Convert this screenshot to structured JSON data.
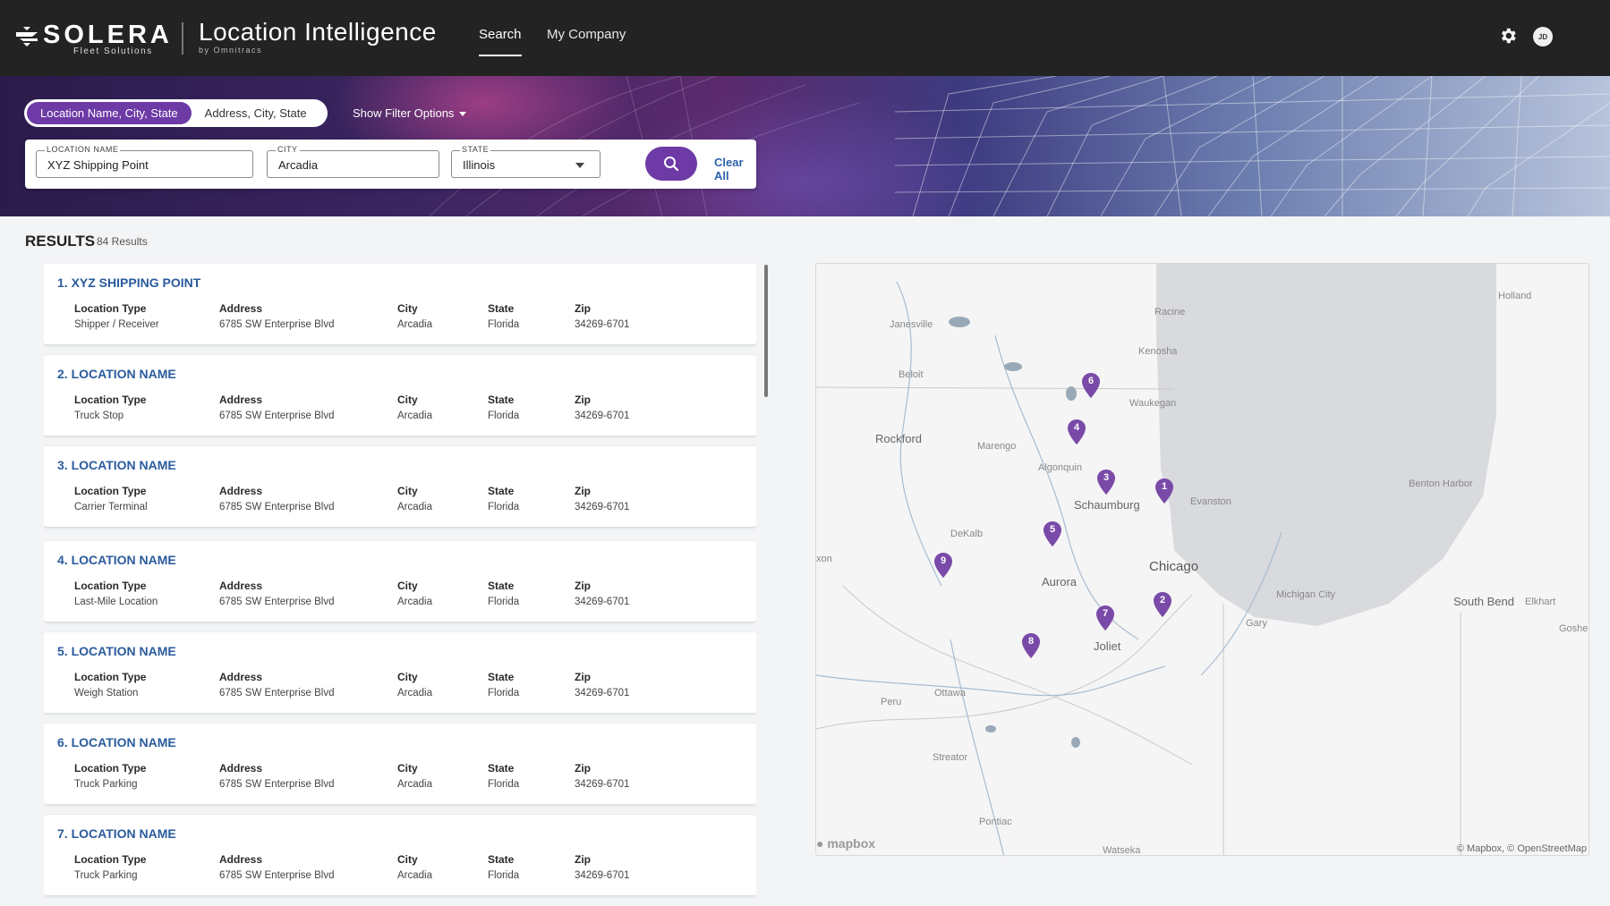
{
  "header": {
    "brand": "SOLERA",
    "brand_sub": "Fleet Solutions",
    "product_title": "Location Intelligence",
    "product_sub": "by Omnitracs",
    "nav": [
      {
        "label": "Search",
        "active": true
      },
      {
        "label": "My Company",
        "active": false
      }
    ],
    "avatar_initials": "JD",
    "icons": {
      "settings": "gear-icon",
      "avatar": "user-avatar"
    }
  },
  "search": {
    "modes": [
      {
        "label": "Location Name, City, State",
        "active": true
      },
      {
        "label": "Address, City, State",
        "active": false
      }
    ],
    "filter_toggle": "Show Filter Options",
    "fields": {
      "location_name": {
        "label": "LOCATION NAME",
        "value": "XYZ Shipping Point"
      },
      "city": {
        "label": "CITY",
        "value": "Arcadia"
      },
      "state": {
        "label": "STATE",
        "value": "Illinois"
      }
    },
    "clear_all": "Clear All",
    "accent_color": "#6d3aa6"
  },
  "results": {
    "title": "RESULTS",
    "count": "84 Results",
    "columns": {
      "type": "Location Type",
      "address": "Address",
      "city": "City",
      "state": "State",
      "zip": "Zip"
    },
    "items": [
      {
        "title": "1. XYZ SHIPPING POINT",
        "type": "Shipper / Receiver",
        "address": "6785 SW Enterprise Blvd",
        "city": "Arcadia",
        "state": "Florida",
        "zip": "34269-6701"
      },
      {
        "title": "2. LOCATION NAME",
        "type": "Truck Stop",
        "address": "6785 SW Enterprise Blvd",
        "city": "Arcadia",
        "state": "Florida",
        "zip": "34269-6701"
      },
      {
        "title": "3. LOCATION NAME",
        "type": "Carrier Terminal",
        "address": "6785 SW Enterprise Blvd",
        "city": "Arcadia",
        "state": "Florida",
        "zip": "34269-6701"
      },
      {
        "title": "4. LOCATION NAME",
        "type": "Last-Mile Location",
        "address": "6785 SW Enterprise Blvd",
        "city": "Arcadia",
        "state": "Florida",
        "zip": "34269-6701"
      },
      {
        "title": "5. LOCATION NAME",
        "type": "Weigh Station",
        "address": "6785 SW Enterprise Blvd",
        "city": "Arcadia",
        "state": "Florida",
        "zip": "34269-6701"
      },
      {
        "title": "6. LOCATION NAME",
        "type": "Truck Parking",
        "address": "6785 SW Enterprise Blvd",
        "city": "Arcadia",
        "state": "Florida",
        "zip": "34269-6701"
      },
      {
        "title": "7. LOCATION NAME",
        "type": "Truck Parking",
        "address": "6785 SW Enterprise Blvd",
        "city": "Arcadia",
        "state": "Florida",
        "zip": "34269-6701"
      }
    ]
  },
  "map": {
    "places": {
      "holland": "Holland",
      "racine": "Racine",
      "janesville": "Janesville",
      "kenosha": "Kenosha",
      "beloit": "Beloit",
      "waukegan": "Waukegan",
      "rockford": "Rockford",
      "marengo": "Marengo",
      "algonquin": "Algonquin",
      "benton_harbor": "Benton Harbor",
      "schaumburg": "Schaumburg",
      "evanston": "Evanston",
      "dekalb": "DeKalb",
      "chicago": "Chicago",
      "aurora": "Aurora",
      "michigan_city": "Michigan City",
      "south_bend": "South Bend",
      "elkhart": "Elkhart",
      "gary": "Gary",
      "goshen": "Goshen",
      "joliet": "Joliet",
      "peru": "Peru",
      "ottawa": "Ottawa",
      "streator": "Streator",
      "pontiac": "Pontiac",
      "watseka": "Watseka",
      "dixon": "xon"
    },
    "pins": [
      "1",
      "2",
      "3",
      "4",
      "5",
      "6",
      "7",
      "8",
      "9"
    ],
    "pin_color": "#7a4aa8",
    "logo": "mapbox",
    "attribution": "© Mapbox, © OpenStreetMap"
  }
}
